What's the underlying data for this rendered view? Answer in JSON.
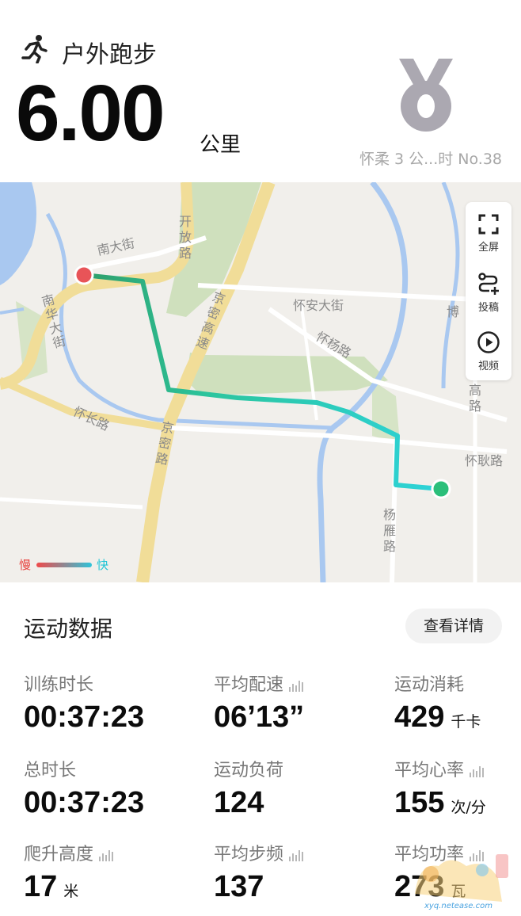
{
  "header": {
    "activity_type": "户外跑步",
    "distance": "6.00",
    "distance_unit": "公里",
    "medal_caption": "怀柔 3 公...时 No.38"
  },
  "map": {
    "labels": {
      "nandajie": "南大街",
      "kaifanglu": "开放路",
      "nanhuadajie": "南华大街",
      "jingmigaosu": "京密高速",
      "huaiandajie": "怀安大街",
      "huaiyanglu": "怀杨路",
      "huaichanglu": "怀长路",
      "jingmilu": "京密路",
      "bo": "博",
      "gaolu": "高路",
      "huaigenglu": "怀耿路",
      "yangyanlu": "杨雁路"
    },
    "toolbar": {
      "fullscreen": "全屏",
      "post": "投稿",
      "video": "视频"
    },
    "legend": {
      "slow": "慢",
      "fast": "快"
    },
    "colors": {
      "start": "#e85458",
      "end": "#2bbf7a",
      "slow": "#ef4a4a",
      "fast": "#2fc4d9"
    }
  },
  "stats": {
    "section_title": "运动数据",
    "details_button": "查看详情",
    "items": [
      {
        "label": "训练时长",
        "value": "00:37:23",
        "unit": ""
      },
      {
        "label": "平均配速",
        "value": "06’13”",
        "unit": ""
      },
      {
        "label": "运动消耗",
        "value": "429",
        "unit": "千卡"
      },
      {
        "label": "总时长",
        "value": "00:37:23",
        "unit": ""
      },
      {
        "label": "运动负荷",
        "value": "124",
        "unit": ""
      },
      {
        "label": "平均心率",
        "value": "155",
        "unit": "次/分"
      },
      {
        "label": "爬升高度",
        "value": "17",
        "unit": "米"
      },
      {
        "label": "平均步频",
        "value": "137",
        "unit": ""
      },
      {
        "label": "平均功率",
        "value": "273",
        "unit": "瓦"
      }
    ]
  },
  "watermark": {
    "text": "xyq.netease.com"
  }
}
